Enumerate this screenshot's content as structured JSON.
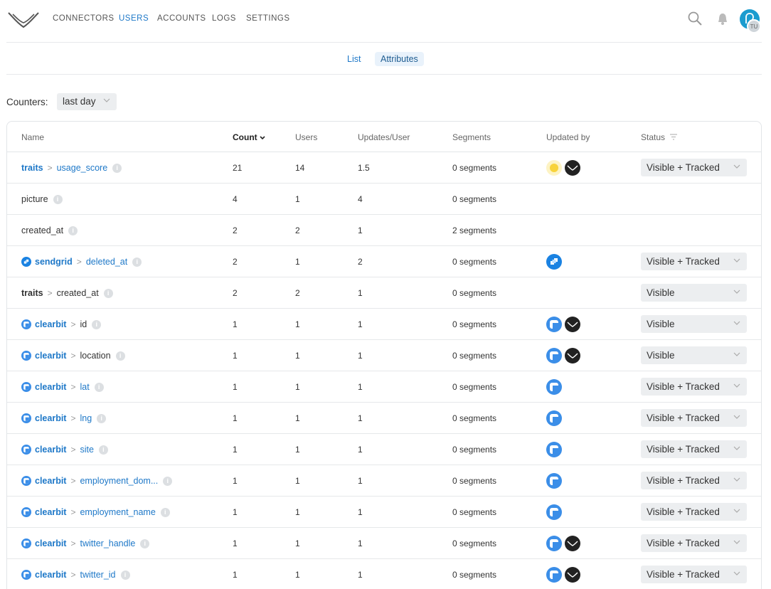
{
  "nav": {
    "items": [
      {
        "label": "CONNECTORS",
        "active": false
      },
      {
        "label": "USERS",
        "active": true
      },
      {
        "label": "ACCOUNTS",
        "active": false
      },
      {
        "label": "LOGS",
        "active": false
      },
      {
        "label": "SETTINGS",
        "active": false
      }
    ],
    "avatar_initials": "TU",
    "icons": [
      "search-icon",
      "bell-icon"
    ]
  },
  "subtabs": [
    {
      "label": "List",
      "active": false
    },
    {
      "label": "Attributes",
      "active": true
    }
  ],
  "counters": {
    "label": "Counters:",
    "value": "last day"
  },
  "table": {
    "columns": {
      "name": "Name",
      "count": "Count",
      "users": "Users",
      "updates_per_user": "Updates/User",
      "segments": "Segments",
      "updated_by": "Updated by",
      "status": "Status"
    },
    "rows": [
      {
        "source": "traits",
        "attribute": "usage_score",
        "linked": true,
        "source_icon": "",
        "count": "21",
        "users": "14",
        "updates": "1.5",
        "segments": "0 segments",
        "updated_by": [
          "sun-icon",
          "hull-icon"
        ],
        "status": "Visible + Tracked"
      },
      {
        "source": "",
        "attribute": "picture",
        "linked": false,
        "source_icon": "",
        "count": "4",
        "users": "1",
        "updates": "4",
        "segments": "0 segments",
        "updated_by": [],
        "status": ""
      },
      {
        "source": "",
        "attribute": "created_at",
        "linked": false,
        "source_icon": "",
        "count": "2",
        "users": "2",
        "updates": "1",
        "segments": "2 segments",
        "updated_by": [],
        "status": ""
      },
      {
        "source": "sendgrid",
        "attribute": "deleted_at",
        "linked": true,
        "source_icon": "sendgrid-icon",
        "count": "2",
        "users": "1",
        "updates": "2",
        "segments": "0 segments",
        "updated_by": [
          "sendgrid-icon"
        ],
        "status": "Visible + Tracked"
      },
      {
        "source": "traits",
        "attribute": "created_at",
        "linked": false,
        "source_icon": "",
        "count": "2",
        "users": "2",
        "updates": "1",
        "segments": "0 segments",
        "updated_by": [],
        "status": "Visible"
      },
      {
        "source": "clearbit",
        "attribute": "id",
        "linked": false,
        "source_icon": "clearbit-icon",
        "count": "1",
        "users": "1",
        "updates": "1",
        "segments": "0 segments",
        "updated_by": [
          "clearbit-icon",
          "hull-icon"
        ],
        "status": "Visible"
      },
      {
        "source": "clearbit",
        "attribute": "location",
        "linked": false,
        "source_icon": "clearbit-icon",
        "count": "1",
        "users": "1",
        "updates": "1",
        "segments": "0 segments",
        "updated_by": [
          "clearbit-icon",
          "hull-icon"
        ],
        "status": "Visible"
      },
      {
        "source": "clearbit",
        "attribute": "lat",
        "linked": true,
        "source_icon": "clearbit-icon",
        "count": "1",
        "users": "1",
        "updates": "1",
        "segments": "0 segments",
        "updated_by": [
          "clearbit-icon"
        ],
        "status": "Visible + Tracked"
      },
      {
        "source": "clearbit",
        "attribute": "lng",
        "linked": true,
        "source_icon": "clearbit-icon",
        "count": "1",
        "users": "1",
        "updates": "1",
        "segments": "0 segments",
        "updated_by": [
          "clearbit-icon"
        ],
        "status": "Visible + Tracked"
      },
      {
        "source": "clearbit",
        "attribute": "site",
        "linked": true,
        "source_icon": "clearbit-icon",
        "count": "1",
        "users": "1",
        "updates": "1",
        "segments": "0 segments",
        "updated_by": [
          "clearbit-icon"
        ],
        "status": "Visible + Tracked"
      },
      {
        "source": "clearbit",
        "attribute": "employment_dom...",
        "linked": true,
        "source_icon": "clearbit-icon",
        "count": "1",
        "users": "1",
        "updates": "1",
        "segments": "0 segments",
        "updated_by": [
          "clearbit-icon"
        ],
        "status": "Visible + Tracked"
      },
      {
        "source": "clearbit",
        "attribute": "employment_name",
        "linked": true,
        "source_icon": "clearbit-icon",
        "count": "1",
        "users": "1",
        "updates": "1",
        "segments": "0 segments",
        "updated_by": [
          "clearbit-icon"
        ],
        "status": "Visible + Tracked"
      },
      {
        "source": "clearbit",
        "attribute": "twitter_handle",
        "linked": true,
        "source_icon": "clearbit-icon",
        "count": "1",
        "users": "1",
        "updates": "1",
        "segments": "0 segments",
        "updated_by": [
          "clearbit-icon",
          "hull-icon"
        ],
        "status": "Visible + Tracked"
      },
      {
        "source": "clearbit",
        "attribute": "twitter_id",
        "linked": true,
        "source_icon": "clearbit-icon",
        "count": "1",
        "users": "1",
        "updates": "1",
        "segments": "0 segments",
        "updated_by": [
          "clearbit-icon",
          "hull-icon"
        ],
        "status": "Visible + Tracked"
      }
    ]
  },
  "colors": {
    "accent": "#1e78c8",
    "clearbit": "#3b8ee8",
    "sendgrid": "#1a82e2",
    "hull": "#222222",
    "sun": "#f8d33a"
  }
}
